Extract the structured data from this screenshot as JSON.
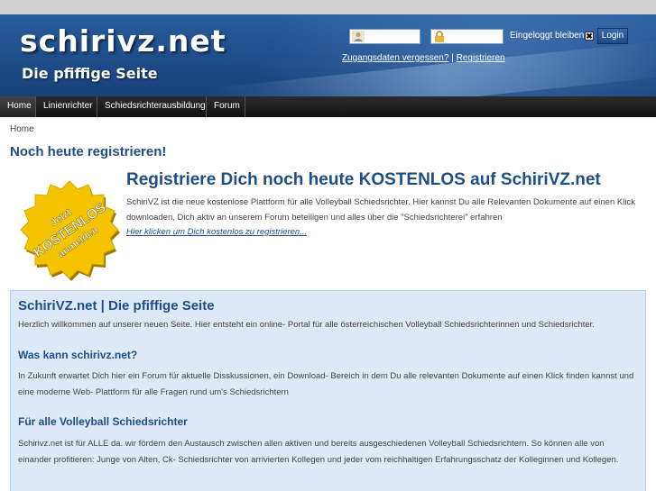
{
  "header": {
    "site_title": "schirivz.net",
    "slogan": "Die pfiffige Seite",
    "remember_label": "Eingeloggt bleiben",
    "remember_mark": "✖",
    "login_label": "Login",
    "forgot_link": "Zugangsdaten vergessen?",
    "separator": "|",
    "register_link": "Registrieren"
  },
  "nav": {
    "items": [
      {
        "label": "Home"
      },
      {
        "label": "Linienrichter"
      },
      {
        "label": "Schiedsrichterausbildung"
      },
      {
        "label": "Forum"
      }
    ]
  },
  "breadcrumb": "Home",
  "page_title": "Noch heute registrieren!",
  "promo": {
    "badge_lines": [
      "Jetzt",
      "KOSTENLOS",
      "anmelden"
    ],
    "title": "Registriere Dich noch heute KOSTENLOS auf SchiriVZ.net",
    "text": "SchiriVZ ist die neue kostenlose Plattform für alle Volleyball Schiedsrichter. Hier kannst Du alle Relevanten Dokumente auf einen Klick downloaden, Dich aktiv an unserem Forum beteiligen und alles über die \"Schiedsrichterei\" erfahren",
    "link": "Hier klicken um Dich kostenlos zu registrieren..."
  },
  "content": {
    "title": "SchiriVZ.net | Die pfiffige Seite",
    "intro": "Herzlich willkommen auf unserer neuen Seite. Hier entsteht ein online- Portal für alle österreichischen Volleyball Schiedsrichterinnen und Schiedsrichter.",
    "h1": "Was kann schirivz.net?",
    "p1": "In Zukunft erwartet Dich hier ein Forum für aktuelle Disskussionen, ein Download- Bereich in dem Du alle relevanten Dokumente auf einen Klick finden kannst und eine moderne Web- Plattform für alle Fragen rund um's Schiedsrichtern",
    "h2": "Für alle Volleyball Schiedsrichter",
    "p2": "Schirivz.net ist für ALLE da. wir fördern den Austausch zwischen allen aktiven und bereits ausgeschiedenen Volleyball Schiedsrichtern. So können alle von einander profitieren: Junge von Alten, Ck- Schiedsrichter von arrivierten Kollegen und jeder vom reichhaltigen Erfahrungsschatz der Kolleginnen und Kollegen."
  },
  "colors": {
    "header_blue": "#1f4f8c",
    "heading_blue": "#1d4e86",
    "badge_yellow": "#f5c400",
    "box_bg": "#dde9f7"
  }
}
